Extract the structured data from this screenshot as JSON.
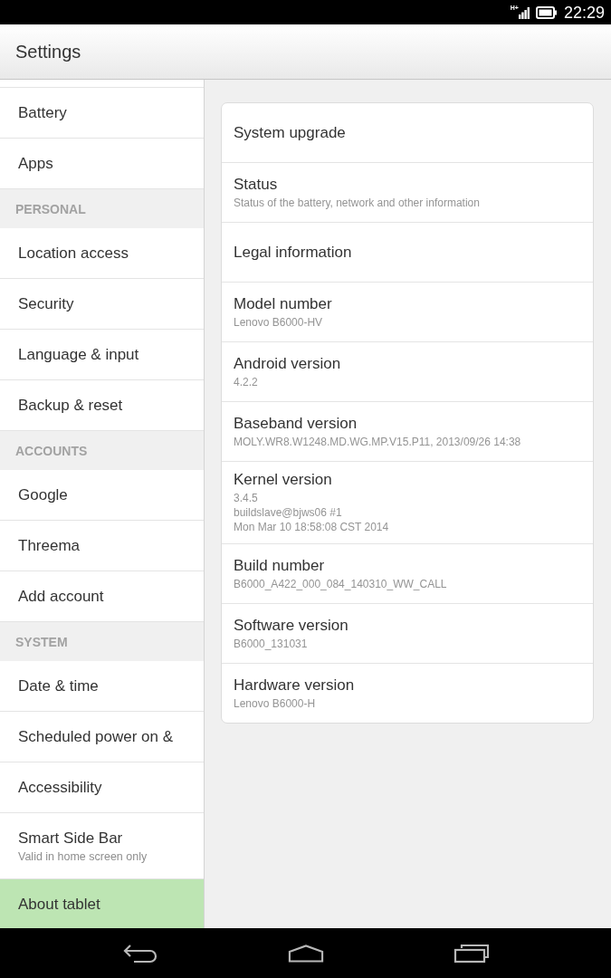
{
  "status_bar": {
    "network_type": "H+",
    "time": "22:29"
  },
  "action_bar": {
    "title": "Settings"
  },
  "sidebar": {
    "items": [
      {
        "kind": "item",
        "label": "Battery",
        "selected": false
      },
      {
        "kind": "item",
        "label": "Apps",
        "selected": false
      },
      {
        "kind": "header",
        "label": "PERSONAL"
      },
      {
        "kind": "item",
        "label": "Location access",
        "selected": false
      },
      {
        "kind": "item",
        "label": "Security",
        "selected": false
      },
      {
        "kind": "item",
        "label": "Language & input",
        "selected": false
      },
      {
        "kind": "item",
        "label": "Backup & reset",
        "selected": false
      },
      {
        "kind": "header",
        "label": "ACCOUNTS"
      },
      {
        "kind": "item",
        "label": "Google",
        "selected": false
      },
      {
        "kind": "item",
        "label": "Threema",
        "selected": false
      },
      {
        "kind": "item",
        "label": "Add account",
        "selected": false
      },
      {
        "kind": "header",
        "label": "SYSTEM"
      },
      {
        "kind": "item",
        "label": "Date & time",
        "selected": false
      },
      {
        "kind": "item",
        "label": "Scheduled power on &",
        "selected": false
      },
      {
        "kind": "item",
        "label": "Accessibility",
        "selected": false
      },
      {
        "kind": "item",
        "label": "Smart Side Bar",
        "summary": "Valid in home screen only",
        "selected": false
      },
      {
        "kind": "item",
        "label": "About tablet",
        "selected": true
      }
    ]
  },
  "details": {
    "items": [
      {
        "title": "System upgrade"
      },
      {
        "title": "Status",
        "summary": "Status of the battery, network and other information"
      },
      {
        "title": "Legal information"
      },
      {
        "title": "Model number",
        "summary": "Lenovo B6000-HV"
      },
      {
        "title": "Android version",
        "summary": "4.2.2"
      },
      {
        "title": "Baseband version",
        "summary": "MOLY.WR8.W1248.MD.WG.MP.V15.P11, 2013/09/26 14:38"
      },
      {
        "title": "Kernel version",
        "summary": "3.4.5\nbuildslave@bjws06 #1\nMon Mar 10 18:58:08 CST 2014"
      },
      {
        "title": "Build number",
        "summary": "B6000_A422_000_084_140310_WW_CALL"
      },
      {
        "title": "Software version",
        "summary": "B6000_131031"
      },
      {
        "title": "Hardware version",
        "summary": "Lenovo B6000-H"
      }
    ]
  },
  "navigation_bar": {
    "buttons": [
      {
        "kind": "back"
      },
      {
        "kind": "home"
      },
      {
        "kind": "recents"
      }
    ]
  }
}
